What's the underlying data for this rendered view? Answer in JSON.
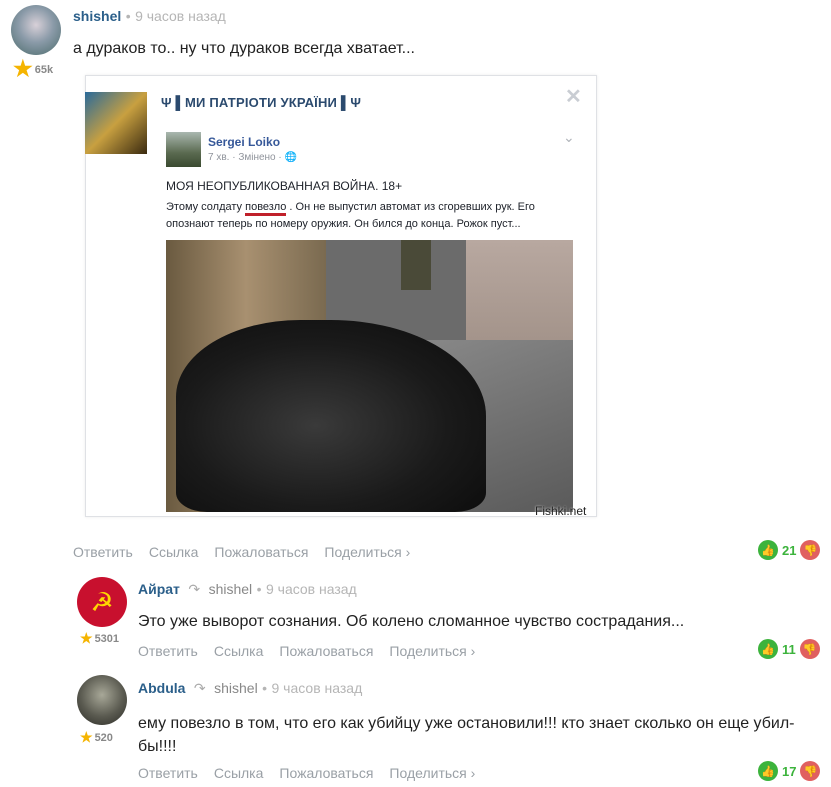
{
  "comment1": {
    "username": "shishel",
    "time": "9 часов назад",
    "rating": "65k",
    "text": "а дураков то.. ну что дураков всегда хватает...",
    "score": "21"
  },
  "embed": {
    "page_title": "Ψ ▌МИ ПАТРІОТИ УКРАЇНИ ▌Ψ",
    "author": "Sergei Loiko",
    "post_meta": "7 хв. · Змінено · ",
    "post_title": "МОЯ НЕОПУБЛИКОВАННАЯ ВОЙНА. 18+",
    "post_text_before": "Этому солдату ",
    "post_text_underline": "повезло",
    "post_text_after": " .  Он не выпустил автомат из сгоревших рук. Его опознают теперь по номеру оружия. Он бился до конца. Рожок пуст...",
    "watermark": "Fishki.net"
  },
  "actions": {
    "reply": "Ответить",
    "link": "Ссылка",
    "report": "Пожаловаться",
    "share": "Поделиться ›"
  },
  "comment2": {
    "username": "Айрат",
    "reply_to": "shishel",
    "time": "9 часов назад",
    "rating": "5301",
    "text": "Это уже выворот сознания. Об колено сломанное чувство сострадания...",
    "score": "11"
  },
  "comment3": {
    "username": "Abdula",
    "reply_to": "shishel",
    "time": "9 часов назад",
    "rating": "520",
    "text": "ему повезло в том, что его как убийцу уже остановили!!! кто знает сколько он еще убил-бы!!!!",
    "score": "17"
  },
  "colors": {
    "username": "#2b5f8a",
    "upvote": "#3cb33c",
    "downvote": "#e06060"
  },
  "separator": "•"
}
